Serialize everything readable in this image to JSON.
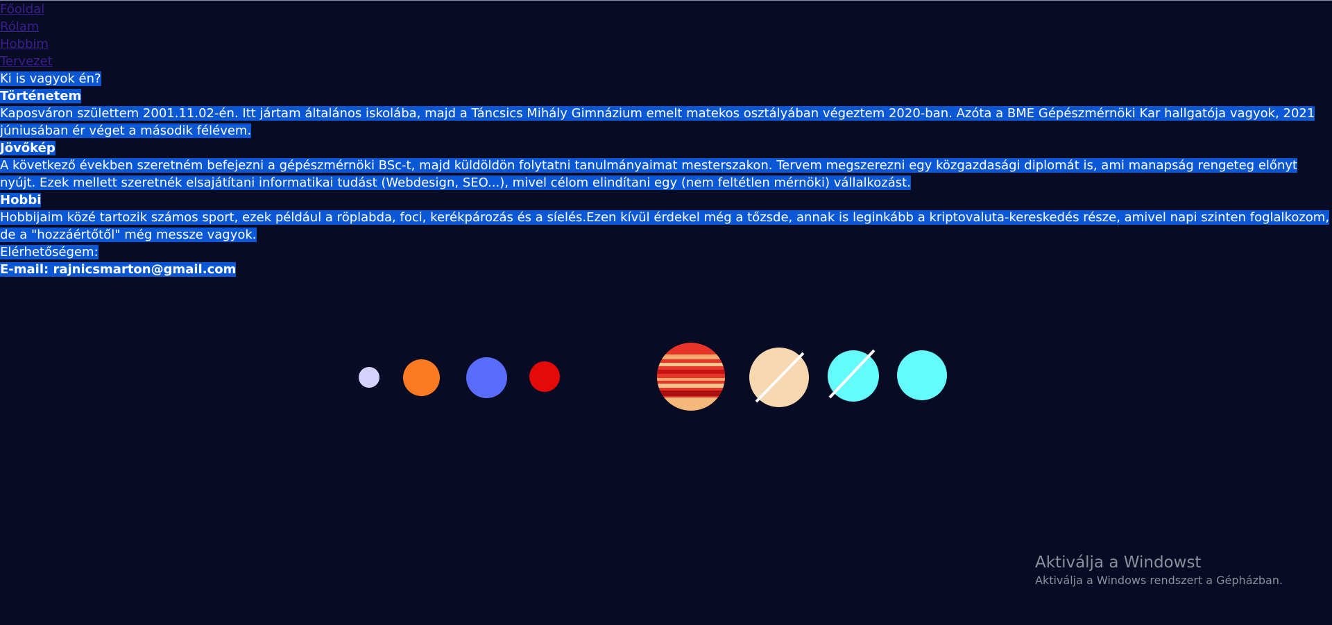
{
  "nav": {
    "items": [
      "Főoldal",
      "Rólam",
      "Hobbim",
      "Tervezet"
    ]
  },
  "intro": {
    "question": "Ki is vagyok én?"
  },
  "history": {
    "heading": "Történetem",
    "line1": "Kaposváron születtem 2001.11.02-én. Itt jártam általános iskolába, majd a Táncsics Mihály Gimnázium emelt matekos osztályában végeztem 2020-ban. Azóta a BME Gépészmérnöki Kar hallgatója vagyok, 2021",
    "line2": "júniusában ér véget a második félévem."
  },
  "future": {
    "heading": "Jövőkép",
    "line1": "A következő években szeretném befejezni a gépészmérnöki BSc-t, majd küldöldön folytatni tanulmányaimat mesterszakon. Tervem megszerezni egy közgazdasági diplomát is, ami manapság rengeteg előnyt",
    "line2": "nyújt. Ezek mellett szeretnék elsajátítani informatikai tudást (Webdesign, SEO...), mivel célom elindítani egy (nem feltétlen mérnöki) vállalkozást."
  },
  "hobby": {
    "heading": "Hobbi",
    "line1": "Hobbijaim közé tartozik számos sport, ezek például a röplabda, foci, kerékpározás és a síelés.Ezen kívül érdekel még a tőzsde, annak is leginkább a kriptovaluta-kereskedés része, amivel napi szinten foglalkozom,",
    "line2": "de a \"hozzáértőtől\" még messze vagyok."
  },
  "contact": {
    "label": "Elérhetőségem:",
    "email": "E-mail: rajnicsmarton@gmail.com"
  },
  "watermark": {
    "title": "Aktiválja a Windowst",
    "subtitle": "Aktiválja a Windows rendszert a Gépházban."
  },
  "colors": {
    "background": "#070b24",
    "selection": "#0a58d6",
    "link": "#3b1d8f",
    "mercury": "#d4d2fb",
    "venus": "#fb7a22",
    "earth": "#5a6cfb",
    "mars": "#e40a0a",
    "jupiter": "#e9342a",
    "saturn": "#f7d7b0",
    "uranus": "#63fbfb",
    "neptune": "#63fbfb"
  }
}
